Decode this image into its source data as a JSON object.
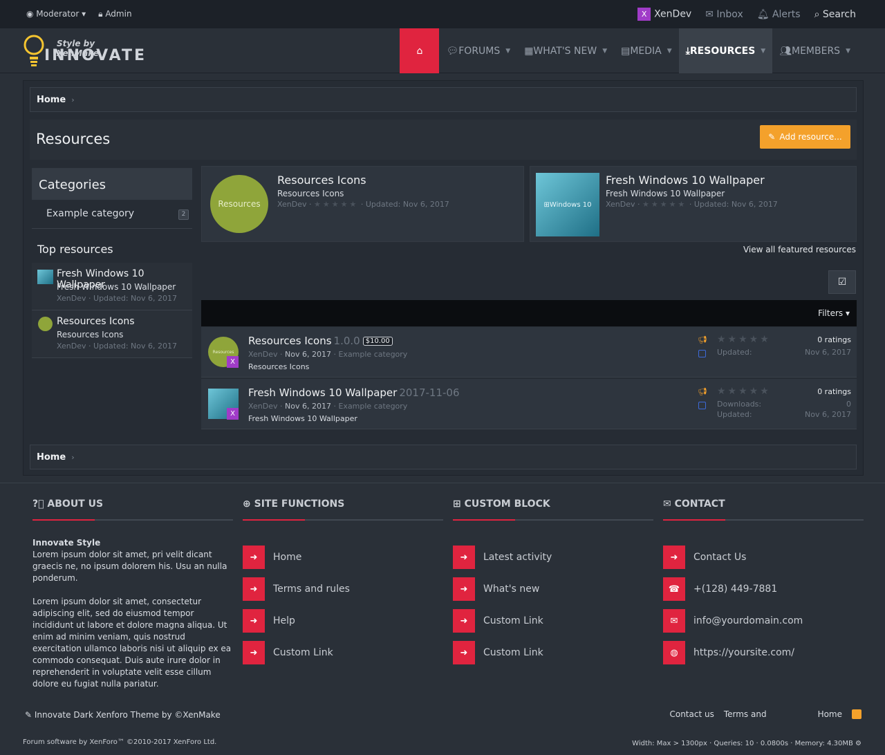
{
  "topbar": {
    "moderator": "Moderator",
    "admin": "Admin",
    "brand": "XenDev",
    "brand_icon": "X",
    "inbox": "Inbox",
    "alerts": "Alerts",
    "search": "Search"
  },
  "logo": {
    "tagline": "Style by XenMake",
    "word": "INNOVATE"
  },
  "nav": {
    "home_icon": "⌂",
    "forums": "FORUMS",
    "whats_new": "WHAT'S NEW",
    "media": "MEDIA",
    "resources": "RESOURCES",
    "members": "MEMBERS"
  },
  "breadcrumb": {
    "home": "Home"
  },
  "page": {
    "title": "Resources",
    "add_resource": "Add resource..."
  },
  "sidebar": {
    "categories_title": "Categories",
    "category": {
      "label": "Example category",
      "count": "2"
    },
    "top_title": "Top resources",
    "top": [
      {
        "title": "Fresh Windows 10 Wallpaper",
        "sub": "Fresh Windows 10 Wallpaper",
        "meta": "XenDev · Updated: Nov 6, 2017"
      },
      {
        "title": "Resources Icons",
        "sub": "Resources Icons",
        "meta": "XenDev · Updated: Nov 6, 2017"
      }
    ]
  },
  "featured": [
    {
      "thumb_text": "Resources",
      "title": "Resources Icons",
      "sub": "Resources Icons",
      "author": "XenDev ·",
      "stars": "★★★★★",
      "updated": "· Updated: Nov 6, 2017"
    },
    {
      "thumb_text": "Windows 10",
      "title": "Fresh Windows 10 Wallpaper",
      "sub": "Fresh Windows 10 Wallpaper",
      "author": "XenDev ·",
      "stars": "★★★★★",
      "updated": "· Updated: Nov 6, 2017"
    }
  ],
  "view_all": "View all featured resources",
  "filters": "Filters",
  "resources": [
    {
      "title": "Resources Icons",
      "version": "1.0.0",
      "price": "$10.00",
      "thumb_text": "Resources",
      "author": "XenDev ·",
      "date": "Nov 6, 2017",
      "category": "· Example category",
      "sub": "Resources Icons",
      "stars": "★★★★★",
      "ratings": "0 ratings",
      "updated_label": "Updated:",
      "updated_value": "Nov 6, 2017"
    },
    {
      "title": "Fresh Windows 10 Wallpaper",
      "version": "2017-11-06",
      "thumb_text": "Windows 10",
      "author": "XenDev ·",
      "date": "Nov 6, 2017",
      "category": "· Example category",
      "sub": "Fresh Windows 10 Wallpaper",
      "stars": "★★★★★",
      "ratings": "0 ratings",
      "downloads_label": "Downloads:",
      "downloads_value": "0",
      "updated_label": "Updated:",
      "updated_value": "Nov 6, 2017"
    }
  ],
  "footer": {
    "about_title": "ABOUT US",
    "about_heading": "Innovate Style",
    "about_p1": "Lorem ipsum dolor sit amet, pri velit dicant graecis ne, no ipsum dolorem his. Usu an nulla ponderum.",
    "about_p2": "Lorem ipsum dolor sit amet, consectetur adipiscing elit, sed do eiusmod tempor incididunt ut labore et dolore magna aliqua. Ut enim ad minim veniam, quis nostrud exercitation ullamco laboris nisi ut aliquip ex ea commodo consequat. Duis aute irure dolor in reprehenderit in voluptate velit esse cillum dolore eu fugiat nulla pariatur.",
    "site_title": "SITE FUNCTIONS",
    "site_links": [
      "Home",
      "Terms and rules",
      "Help",
      "Custom Link"
    ],
    "custom_title": "CUSTOM BLOCK",
    "custom_links": [
      "Latest activity",
      "What's new",
      "Custom Link",
      "Custom Link"
    ],
    "contact_title": "CONTACT",
    "contact_links": [
      "Contact Us",
      "+(128) 449-7881",
      "info@yourdomain.com",
      "https://yoursite.com/"
    ],
    "credit": "Innovate Dark  Xenforo Theme   by   ©XenMake",
    "bottom_links": [
      "Contact us",
      "Terms and",
      "Home"
    ],
    "software": "Forum software by XenForo™ ©2010-2017 XenForo Ltd.",
    "debug": "Width: Max > 1300px · Queries: 10 · 0.0800s · Memory: 4.30MB"
  },
  "colors": {
    "accent": "#e0243f",
    "button": "#f4a12b",
    "badge": "#a03cc8",
    "background": "#2a3038"
  }
}
